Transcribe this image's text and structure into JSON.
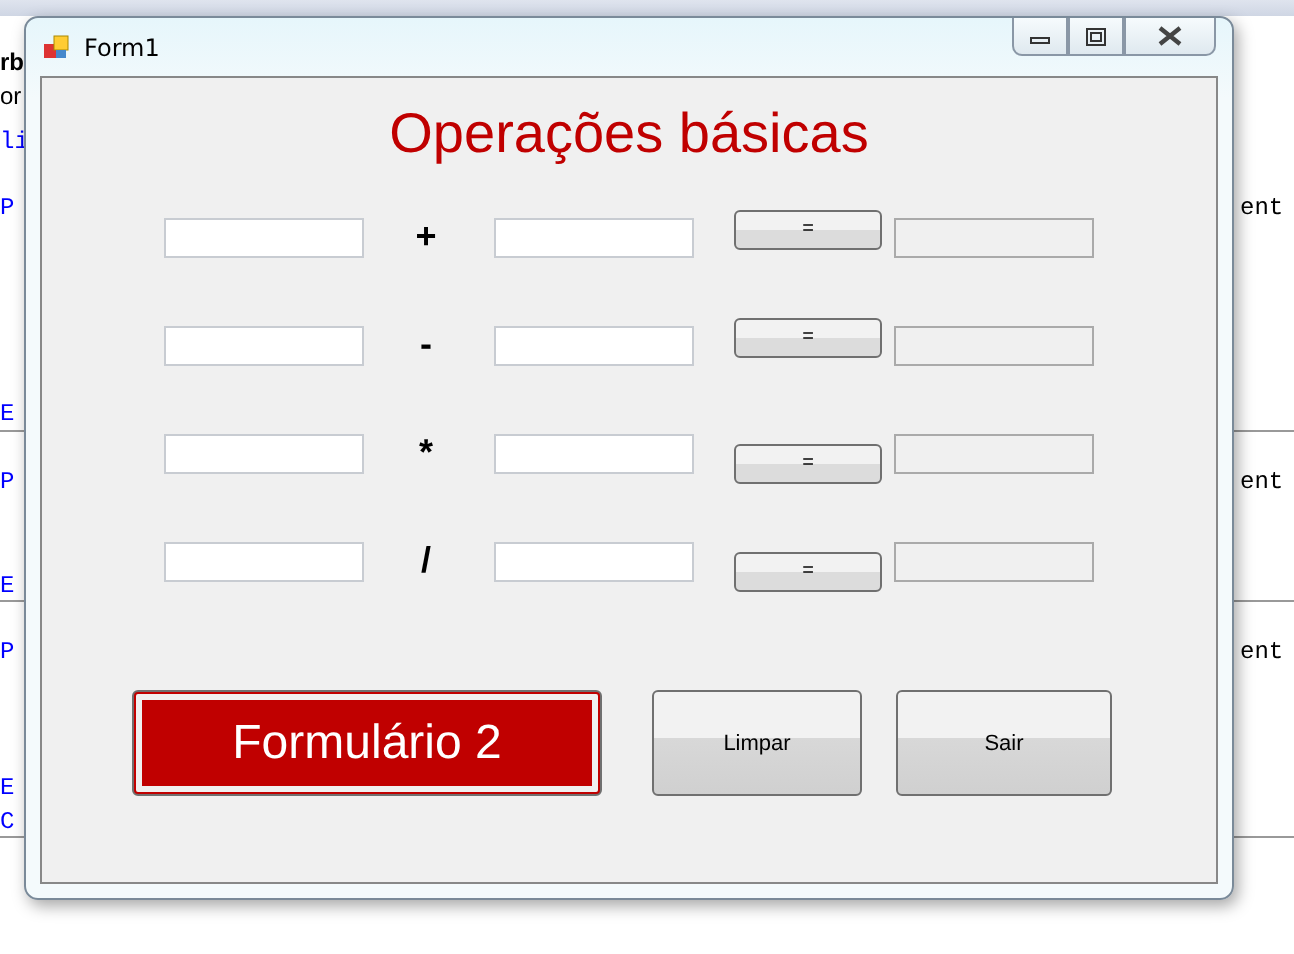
{
  "editor_fragments": {
    "top": [
      "rb",
      "or"
    ],
    "left": [
      "li",
      "P",
      "E",
      "P",
      "E",
      "P",
      "E",
      "C"
    ],
    "right": [
      "ent",
      "ent",
      "ent"
    ]
  },
  "window": {
    "title": "Form1"
  },
  "heading": "Operações básicas",
  "rows": [
    {
      "operator": "+",
      "button": "=",
      "result_readonly": true
    },
    {
      "operator": "-",
      "button": "=",
      "result_readonly": true
    },
    {
      "operator": "*",
      "button": "=",
      "result_readonly": true
    },
    {
      "operator": "/",
      "button": "=",
      "result_readonly": true
    }
  ],
  "buttons": [
    {
      "label": "Formulário 2",
      "kind": "primary"
    },
    {
      "label": "Limpar",
      "kind": "normal"
    },
    {
      "label": "Sair",
      "kind": "normal"
    }
  ]
}
